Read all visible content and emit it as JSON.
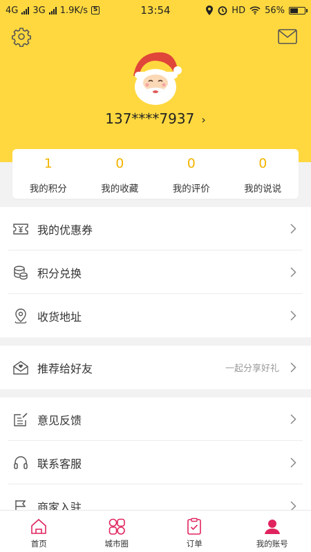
{
  "status_bar": {
    "network1": "4G",
    "network2": "3G",
    "speed": "1.9K/s",
    "time": "13:54",
    "hd": "HD",
    "battery": "56%",
    "battery_level": 0.56
  },
  "profile": {
    "phone": "137****7937",
    "chevron": "›"
  },
  "stats": [
    {
      "value": "1",
      "label": "我的积分"
    },
    {
      "value": "0",
      "label": "我的收藏"
    },
    {
      "value": "0",
      "label": "我的评价"
    },
    {
      "value": "0",
      "label": "我的说说"
    }
  ],
  "menu": {
    "coupons": "我的优惠券",
    "points_exchange": "积分兑换",
    "address": "收货地址",
    "recommend": "推荐给好友",
    "recommend_hint": "一起分享好礼",
    "feedback": "意见反馈",
    "service": "联系客服",
    "merchant": "商家入驻"
  },
  "tabs": [
    {
      "label": "首页",
      "icon": "home-icon"
    },
    {
      "label": "城市圈",
      "icon": "city-circle-icon"
    },
    {
      "label": "订单",
      "icon": "order-icon"
    },
    {
      "label": "我的账号",
      "icon": "account-icon"
    }
  ],
  "colors": {
    "header_yellow": "#ffd83f",
    "stat_number": "#f2b400",
    "tab_accent": "#e0245e"
  }
}
